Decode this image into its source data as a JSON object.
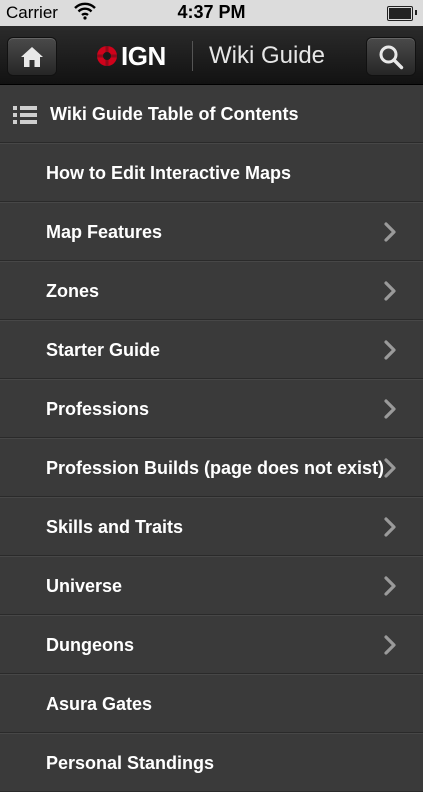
{
  "status_bar": {
    "carrier": "Carrier",
    "time": "4:37 PM",
    "battery_level": 1.0
  },
  "nav": {
    "logo_text": "IGN",
    "title": "Wiki Guide",
    "home_icon": "home-icon",
    "search_icon": "search-icon"
  },
  "toc": {
    "header_label": "Wiki Guide Table of Contents",
    "items": [
      {
        "label": "How to Edit Interactive Maps",
        "has_chevron": false
      },
      {
        "label": "Map Features",
        "has_chevron": true
      },
      {
        "label": "Zones",
        "has_chevron": true
      },
      {
        "label": "Starter Guide",
        "has_chevron": true
      },
      {
        "label": "Professions",
        "has_chevron": true
      },
      {
        "label": "Profession Builds (page does not exist)",
        "has_chevron": true
      },
      {
        "label": "Skills and Traits",
        "has_chevron": true
      },
      {
        "label": "Universe",
        "has_chevron": true
      },
      {
        "label": "Dungeons",
        "has_chevron": true
      },
      {
        "label": "Asura Gates",
        "has_chevron": false
      },
      {
        "label": "Personal Standings",
        "has_chevron": false
      }
    ]
  },
  "colors": {
    "background": "#3a3a3a",
    "navbar": "#1a1a1a",
    "logo_red": "#d0021b",
    "chevron": "#9a9a9a"
  }
}
